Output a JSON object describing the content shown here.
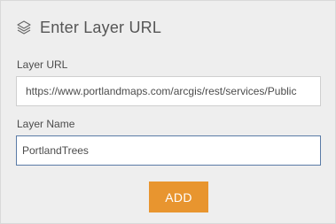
{
  "header": {
    "title": "Enter Layer URL",
    "icon": "layers-icon"
  },
  "form": {
    "url_label": "Layer URL",
    "url_value": "https://www.portlandmaps.com/arcgis/rest/services/Public",
    "name_label": "Layer Name",
    "name_value": "PortlandTrees"
  },
  "actions": {
    "add_label": "ADD"
  },
  "colors": {
    "panel_bg": "#eeeeee",
    "accent_button": "#e8952f",
    "focus_border": "#5a7ba6"
  }
}
